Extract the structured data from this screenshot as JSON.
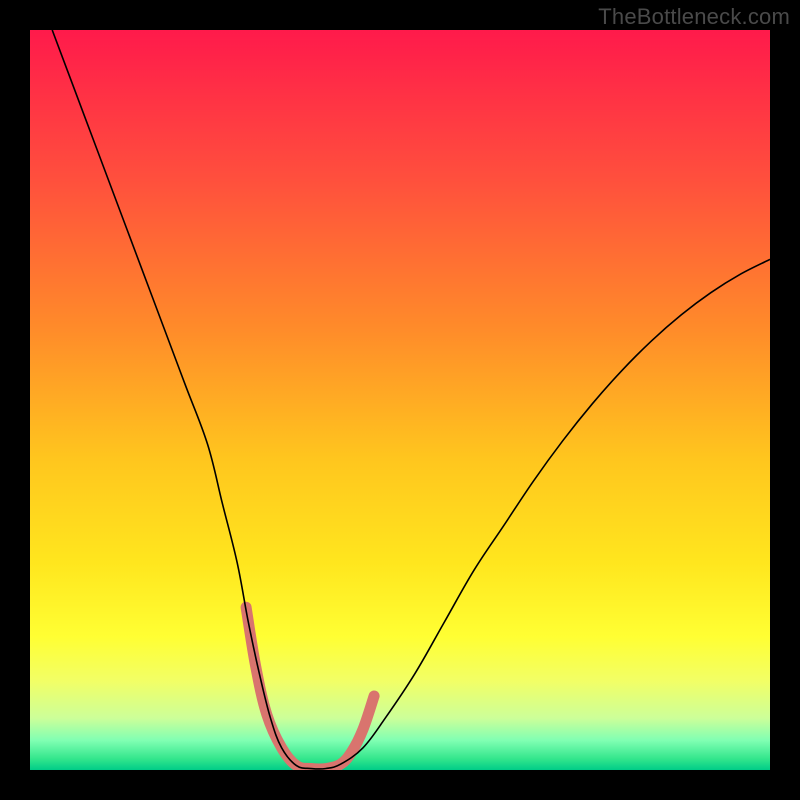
{
  "watermark": {
    "text": "TheBottleneck.com"
  },
  "chart_data": {
    "type": "line",
    "title": "",
    "xlabel": "",
    "ylabel": "",
    "xlim": [
      0,
      100
    ],
    "ylim": [
      0,
      100
    ],
    "grid": false,
    "legend": false,
    "background_gradient": {
      "direction": "vertical",
      "stops": [
        {
          "offset": 0.0,
          "color": "#ff1a4b"
        },
        {
          "offset": 0.2,
          "color": "#ff4f3d"
        },
        {
          "offset": 0.4,
          "color": "#ff8a2a"
        },
        {
          "offset": 0.58,
          "color": "#ffc61e"
        },
        {
          "offset": 0.72,
          "color": "#ffe61e"
        },
        {
          "offset": 0.82,
          "color": "#ffff33"
        },
        {
          "offset": 0.88,
          "color": "#f2ff66"
        },
        {
          "offset": 0.93,
          "color": "#ccff99"
        },
        {
          "offset": 0.96,
          "color": "#80ffb3"
        },
        {
          "offset": 0.985,
          "color": "#33e68c"
        },
        {
          "offset": 1.0,
          "color": "#00cc88"
        }
      ]
    },
    "series": [
      {
        "name": "bottleneck-curve",
        "color": "#000000",
        "width": 1.6,
        "x": [
          3,
          6,
          9,
          12,
          15,
          18,
          21,
          24,
          26,
          28,
          29.5,
          31,
          32.5,
          34,
          36,
          38,
          40,
          42,
          45,
          48,
          52,
          56,
          60,
          64,
          68,
          72,
          76,
          80,
          84,
          88,
          92,
          96,
          100
        ],
        "y": [
          100,
          92,
          84,
          76,
          68,
          60,
          52,
          44,
          36,
          28,
          20,
          13,
          7,
          3,
          0.6,
          0.2,
          0.2,
          0.8,
          3,
          7,
          13,
          20,
          27,
          33,
          39,
          44.5,
          49.5,
          54,
          58,
          61.5,
          64.5,
          67,
          69
        ]
      },
      {
        "name": "bottleneck-region-marker",
        "color": "#d9746e",
        "width": 11,
        "linecap": "round",
        "x": [
          29.2,
          30.5,
          32,
          34,
          36,
          38,
          40,
          42,
          43.5,
          45,
          46.5
        ],
        "y": [
          22,
          14,
          7.5,
          3,
          0.6,
          0.2,
          0.2,
          0.8,
          2.5,
          5.5,
          10
        ]
      }
    ],
    "annotations": []
  }
}
